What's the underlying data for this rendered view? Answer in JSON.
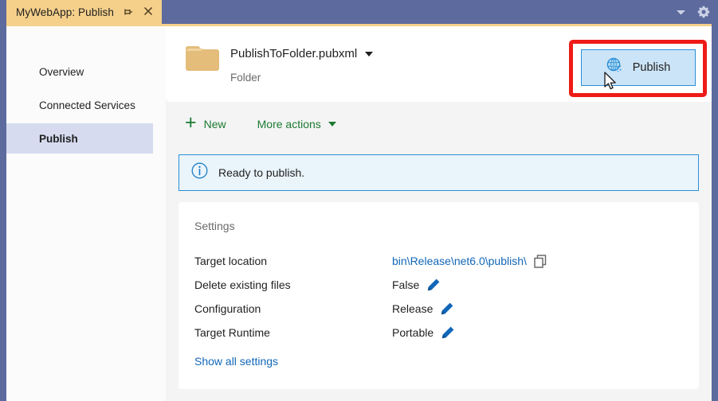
{
  "window": {
    "tab_title": "MyWebApp: Publish",
    "pin_icon": "pin-icon",
    "close_icon": "close-icon",
    "dropdown_icon": "chevron-down-icon",
    "settings_icon": "gear-icon",
    "frame_color": "#5c6a9e",
    "tab_color": "#f5d08b"
  },
  "sidebar": {
    "items": [
      {
        "label": "Overview",
        "selected": false
      },
      {
        "label": "Connected Services",
        "selected": false
      },
      {
        "label": "Publish",
        "selected": true
      }
    ],
    "selected_color": "#d6dbf0"
  },
  "header": {
    "folder_icon": "folder-icon",
    "profile_name": "PublishToFolder.pubxml",
    "profile_dropdown_icon": "chevron-down-icon",
    "profile_type": "Folder",
    "publish_button": {
      "label": "Publish",
      "icon": "publish-globe-icon",
      "background": "#cce4f7",
      "border_color": "#2a8fd6",
      "annotation_color": "#ee1b17"
    },
    "cursor": "mouse-pointer"
  },
  "toolbar": {
    "new_label": "New",
    "new_icon": "plus-icon",
    "more_actions_label": "More actions",
    "more_actions_icon": "chevron-down-icon",
    "accent_color": "#1b7a32"
  },
  "status": {
    "icon": "info-icon",
    "message": "Ready to publish.",
    "background": "#eaf4fb",
    "border_color": "#2a8fd6"
  },
  "settings": {
    "title": "Settings",
    "rows": [
      {
        "label": "Target location",
        "value": "bin\\Release\\net6.0\\publish\\",
        "value_is_link": true,
        "action_icon": "copy-icon"
      },
      {
        "label": "Delete existing files",
        "value": "False",
        "value_is_link": false,
        "action_icon": "edit-pencil-icon"
      },
      {
        "label": "Configuration",
        "value": "Release",
        "value_is_link": false,
        "action_icon": "edit-pencil-icon"
      },
      {
        "label": "Target Runtime",
        "value": "Portable",
        "value_is_link": false,
        "action_icon": "edit-pencil-icon"
      }
    ],
    "show_all_link": "Show all settings",
    "link_color": "#1267b8"
  }
}
